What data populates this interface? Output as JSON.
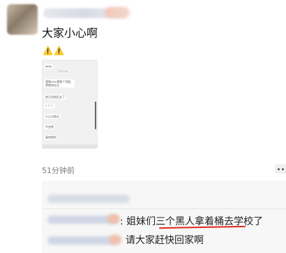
{
  "post": {
    "text": "大家小心啊",
    "warning": "⚠️⚠️",
    "time": "51分钟前"
  },
  "chat_image": {
    "top_label": "wow",
    "time_label": "下午5:46",
    "messages": [
      "我和xxx.跟那个顶层黑楼有在过",
      "他又往校区去了",
      "？？？",
      "小心点各位",
      "不会吧",
      "真的假的"
    ]
  },
  "comments": [
    {
      "text": ": 姐妹们三个黑人拿着桶去学校了"
    },
    {
      "text": "请大家赶快回家啊"
    }
  ],
  "colors": {
    "underline": "#e0271f",
    "warning": "#d4a300"
  }
}
